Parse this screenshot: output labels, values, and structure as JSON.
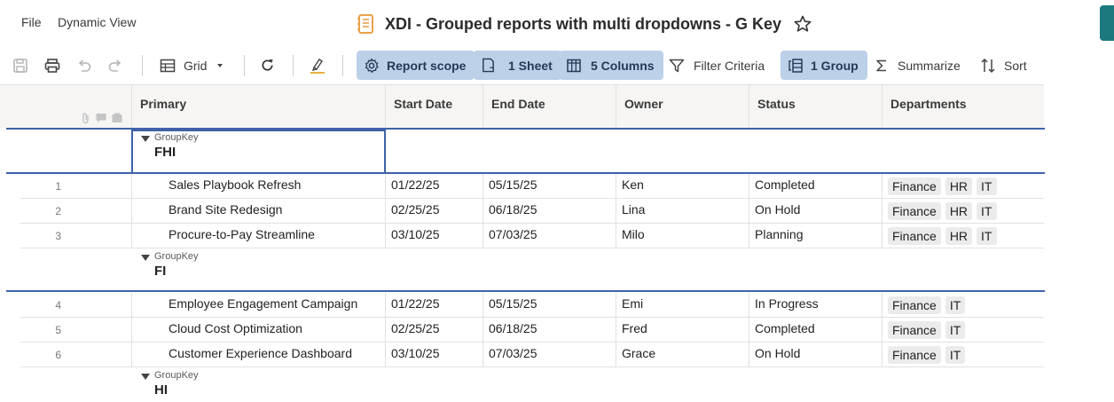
{
  "menu": {
    "file": "File",
    "view": "Dynamic View"
  },
  "title": "XDI - Grouped reports with multi dropdowns - G Key",
  "toolbar": {
    "grid": "Grid",
    "report_scope": "Report scope",
    "sheets": "1 Sheet",
    "columns": "5 Columns",
    "filter": "Filter Criteria",
    "group": "1 Group",
    "summarize": "Summarize",
    "sort": "Sort"
  },
  "columns": [
    "Primary",
    "Start Date",
    "End Date",
    "Owner",
    "Status",
    "Departments"
  ],
  "group_key_label": "GroupKey",
  "groups": [
    {
      "name": "FHI",
      "rows": [
        {
          "num": "1",
          "primary": "Sales Playbook Refresh",
          "start": "01/22/25",
          "end": "05/15/25",
          "owner": "Ken",
          "status": "Completed",
          "departments": [
            "Finance",
            "HR",
            "IT"
          ]
        },
        {
          "num": "2",
          "primary": "Brand Site Redesign",
          "start": "02/25/25",
          "end": "06/18/25",
          "owner": "Lina",
          "status": "On Hold",
          "departments": [
            "Finance",
            "HR",
            "IT"
          ]
        },
        {
          "num": "3",
          "primary": "Procure-to-Pay Streamline",
          "start": "03/10/25",
          "end": "07/03/25",
          "owner": "Milo",
          "status": "Planning",
          "departments": [
            "Finance",
            "HR",
            "IT"
          ]
        }
      ]
    },
    {
      "name": "FI",
      "rows": [
        {
          "num": "4",
          "primary": "Employee Engagement Campaign",
          "start": "01/22/25",
          "end": "05/15/25",
          "owner": "Emi",
          "status": "In Progress",
          "departments": [
            "Finance",
            "IT"
          ]
        },
        {
          "num": "5",
          "primary": "Cloud Cost Optimization",
          "start": "02/25/25",
          "end": "06/18/25",
          "owner": "Fred",
          "status": "Completed",
          "departments": [
            "Finance",
            "IT"
          ]
        },
        {
          "num": "6",
          "primary": "Customer Experience Dashboard",
          "start": "03/10/25",
          "end": "07/03/25",
          "owner": "Grace",
          "status": "On Hold",
          "departments": [
            "Finance",
            "IT"
          ]
        }
      ]
    },
    {
      "name": "HI",
      "rows": []
    }
  ],
  "colors": {
    "accent": "#3f62a8",
    "pill": "#bcd0e8",
    "brand": "#1c7a7e",
    "title_icon": "#e8a24a"
  }
}
